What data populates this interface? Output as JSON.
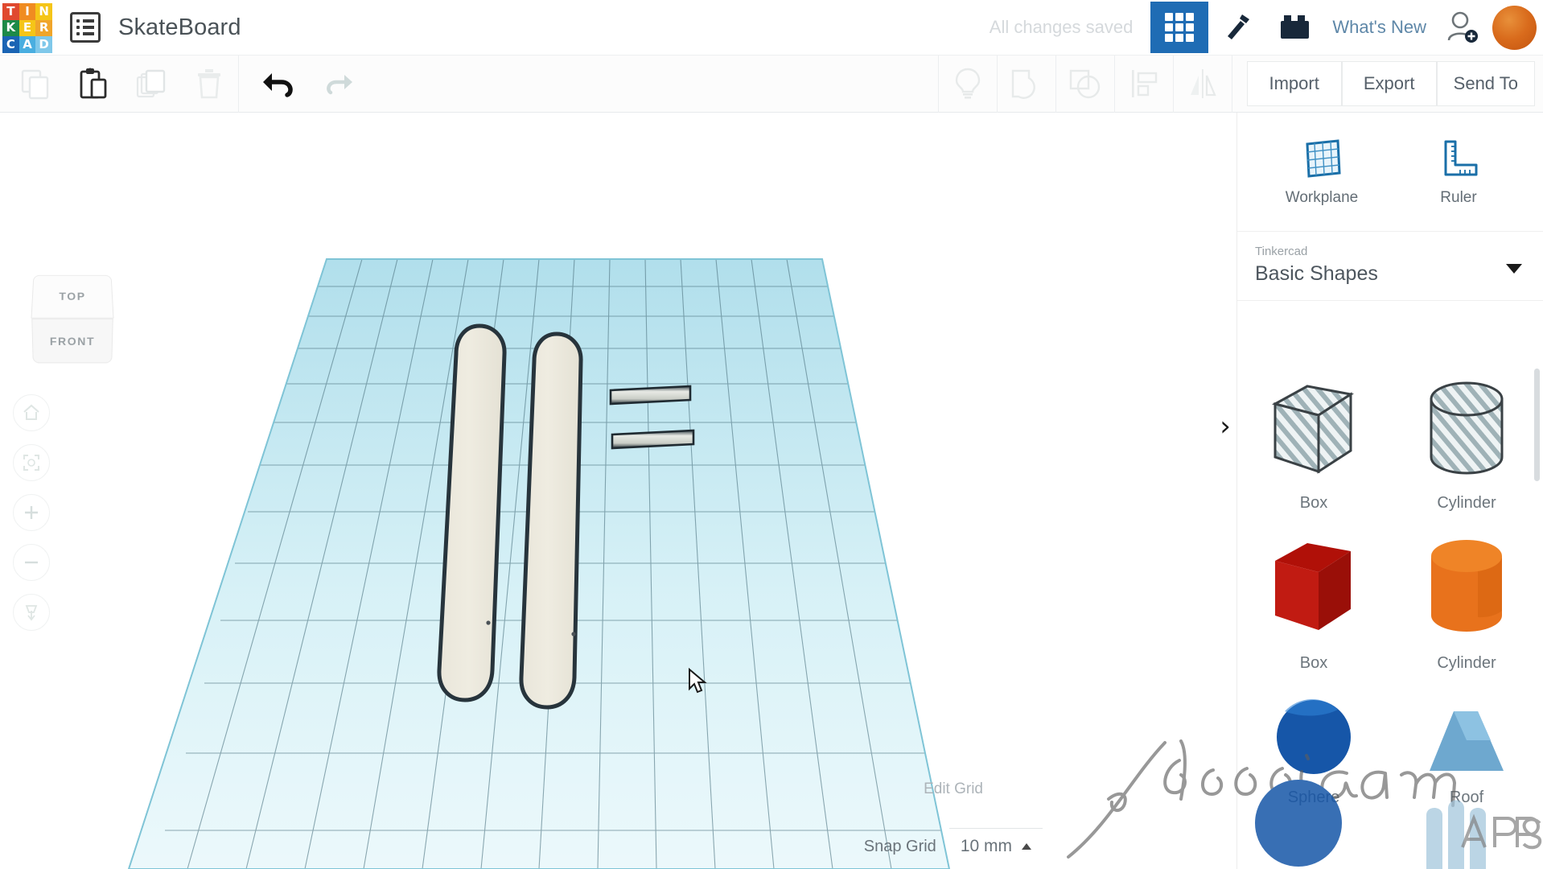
{
  "app": {
    "name": "Tinkercad",
    "logo_letters": [
      "T",
      "I",
      "N",
      "K",
      "E",
      "R",
      "C",
      "A",
      "D"
    ],
    "logo_colors": [
      "#e0492f",
      "#f08c21",
      "#f5c518",
      "#1d8a48",
      "#f5c518",
      "#f0a52a",
      "#1a64b4",
      "#49aee0",
      "#7fc8ea"
    ]
  },
  "topbar": {
    "menu_icon": "list-menu-icon",
    "project_title": "SkateBoard",
    "save_status": "All changes saved",
    "tabs": [
      {
        "name": "design-tab",
        "icon": "grid-3x3-icon",
        "active": true
      },
      {
        "name": "codeblocks-tab",
        "icon": "hammer-icon",
        "active": false
      },
      {
        "name": "blocks-tab",
        "icon": "brick-icon",
        "active": false
      }
    ],
    "whats_new": "What's New",
    "invite_icon": "add-person-icon",
    "avatar": "user-avatar",
    "accent_blue": "#1f6cb4"
  },
  "toolbar": {
    "left_items": [
      {
        "name": "copy-button",
        "icon": "copy-icon",
        "enabled": false
      },
      {
        "name": "paste-button",
        "icon": "paste-icon",
        "enabled": true
      },
      {
        "name": "duplicate-button",
        "icon": "duplicate-icon",
        "enabled": false
      },
      {
        "name": "delete-button",
        "icon": "trash-icon",
        "enabled": false
      },
      {
        "name": "undo-button",
        "icon": "undo-arrow-icon",
        "enabled": true
      },
      {
        "name": "redo-button",
        "icon": "redo-arrow-icon",
        "enabled": false
      }
    ],
    "right_items": [
      {
        "name": "show-hide-button",
        "icon": "lightbulb-icon",
        "enabled": false
      },
      {
        "name": "group-button",
        "icon": "group-shapes-icon",
        "enabled": false
      },
      {
        "name": "ungroup-button",
        "icon": "ungroup-shapes-icon",
        "enabled": false
      },
      {
        "name": "align-button",
        "icon": "align-icon",
        "enabled": false
      },
      {
        "name": "mirror-button",
        "icon": "mirror-icon",
        "enabled": false
      }
    ],
    "import_label": "Import",
    "export_label": "Export",
    "send_to_label": "Send To"
  },
  "viewcube": {
    "top_label": "TOP",
    "front_label": "FRONT"
  },
  "nav": [
    {
      "name": "home-view-button",
      "icon": "home-icon"
    },
    {
      "name": "fit-to-view-button",
      "icon": "fit-view-icon"
    },
    {
      "name": "zoom-in-button",
      "icon": "plus-icon"
    },
    {
      "name": "zoom-out-button",
      "icon": "minus-icon"
    },
    {
      "name": "ortho-perspective-toggle",
      "icon": "perspective-box-icon"
    }
  ],
  "panel": {
    "tools": [
      {
        "name": "workplane-tool",
        "label": "Workplane",
        "icon": "workplane-grid-icon"
      },
      {
        "name": "ruler-tool",
        "label": "Ruler",
        "icon": "ruler-icon"
      }
    ],
    "library_kicker": "Tinkercad",
    "library_value": "Basic Shapes",
    "collapse_icon": "chevron-right-icon",
    "shapes": [
      {
        "name": "shape-hole-box",
        "label": "Box",
        "kind": "hole",
        "color": "#b9c2c4"
      },
      {
        "name": "shape-hole-cylinder",
        "label": "Cylinder",
        "kind": "hole",
        "color": "#b9c2c4"
      },
      {
        "name": "shape-solid-box",
        "label": "Box",
        "kind": "solid",
        "color": "#c11b12"
      },
      {
        "name": "shape-solid-cylinder",
        "label": "Cylinder",
        "kind": "solid",
        "color": "#e8721c"
      },
      {
        "name": "shape-solid-sphere",
        "label": "Sphere",
        "kind": "solid",
        "color": "#1656a8"
      },
      {
        "name": "shape-solid-roof",
        "label": "Roof",
        "kind": "solid",
        "color": "#6ea8cf"
      }
    ]
  },
  "grid_controls": {
    "edit_grid_label": "Edit Grid",
    "snap_grid_label": "Snap Grid",
    "snap_grid_value": "10 mm"
  },
  "scene": {
    "workplane_color": "#bfe6f0",
    "grid_line_color": "#5d7f8c",
    "objects": [
      {
        "name": "deck-part-left",
        "shape": "rounded-capsule",
        "fill": "#eeeade",
        "stroke": "#27343c"
      },
      {
        "name": "deck-part-right",
        "shape": "rounded-capsule",
        "fill": "#eeeade",
        "stroke": "#27343c"
      },
      {
        "name": "truck-bar-top",
        "shape": "thin-bar",
        "fill": "#d9dcd6",
        "stroke": "#1f2a31"
      },
      {
        "name": "truck-bar-bottom",
        "shape": "thin-bar",
        "fill": "#d9dcd6",
        "stroke": "#1f2a31"
      }
    ],
    "cursor": "mouse-pointer"
  },
  "watermark": {
    "line1": "icecream",
    "line2": "APPS"
  }
}
